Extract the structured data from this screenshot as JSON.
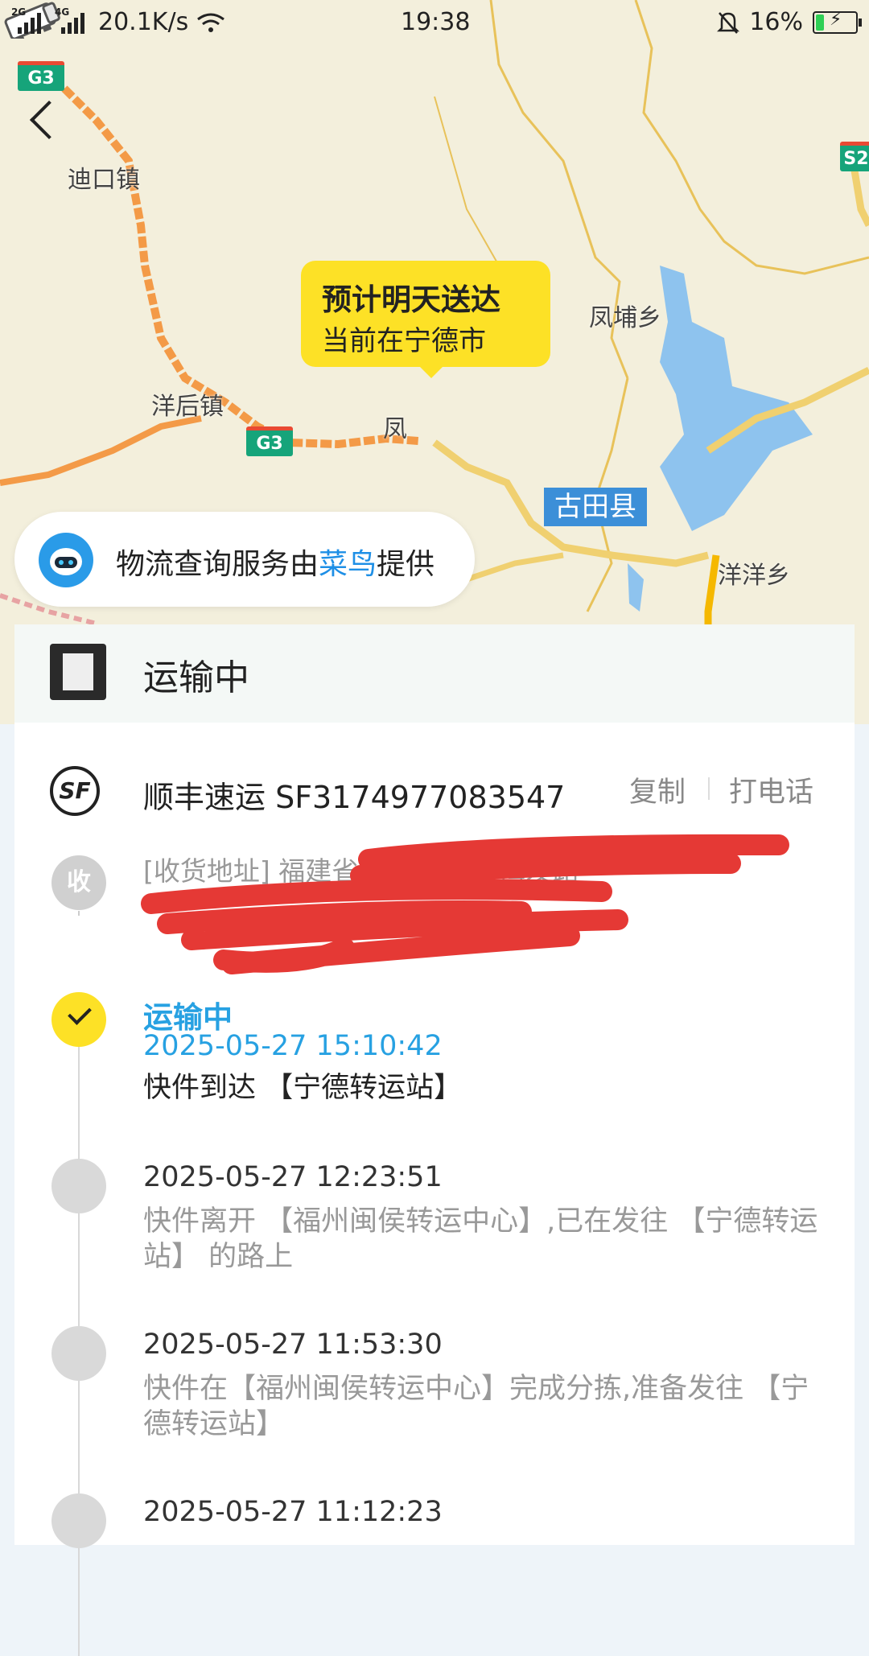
{
  "status_bar": {
    "network1": "2G",
    "network2": "4G",
    "speed": "20.1K/s",
    "time": "19:38",
    "battery": "16%"
  },
  "map": {
    "places": [
      "迪口镇",
      "洋后镇",
      "凤埔乡",
      "洋洋乡",
      "凤"
    ],
    "highway_labels": [
      "G3",
      "G3",
      "S2"
    ],
    "county": "古田县",
    "bubble": {
      "line1": "预计明天送达",
      "line2": "当前在宁德市"
    },
    "provider": {
      "prefix": "物流查询服务由",
      "brand": "菜鸟",
      "suffix": "提供"
    }
  },
  "status_card": {
    "title": "运输中"
  },
  "carrier": {
    "name": "顺丰速运 SF3174977083547",
    "icon": "SF",
    "copy_label": "复制",
    "call_label": "打电话"
  },
  "receiver": {
    "badge": "收",
    "address": "[收货地址] 福建省宁德市福鼎 海发路"
  },
  "events": [
    {
      "status": "运输中",
      "time": "2025-05-27 15:10:42",
      "desc": "快件到达 【宁德转运站】"
    },
    {
      "time": "2025-05-27 12:23:51",
      "desc": "快件离开 【福州闽侯转运中心】,已在发往 【宁德转运站】 的路上"
    },
    {
      "time": "2025-05-27 11:53:30",
      "desc": "快件在【福州闽侯转运中心】完成分拣,准备发往 【宁德转运站】"
    },
    {
      "time": "2025-05-27 11:12:23"
    }
  ],
  "colors": {
    "accent": "#27a1e2",
    "bubble": "#fde126",
    "highway": "#f39a47",
    "water": "#8ec3ee",
    "redaction": "#e53935"
  }
}
